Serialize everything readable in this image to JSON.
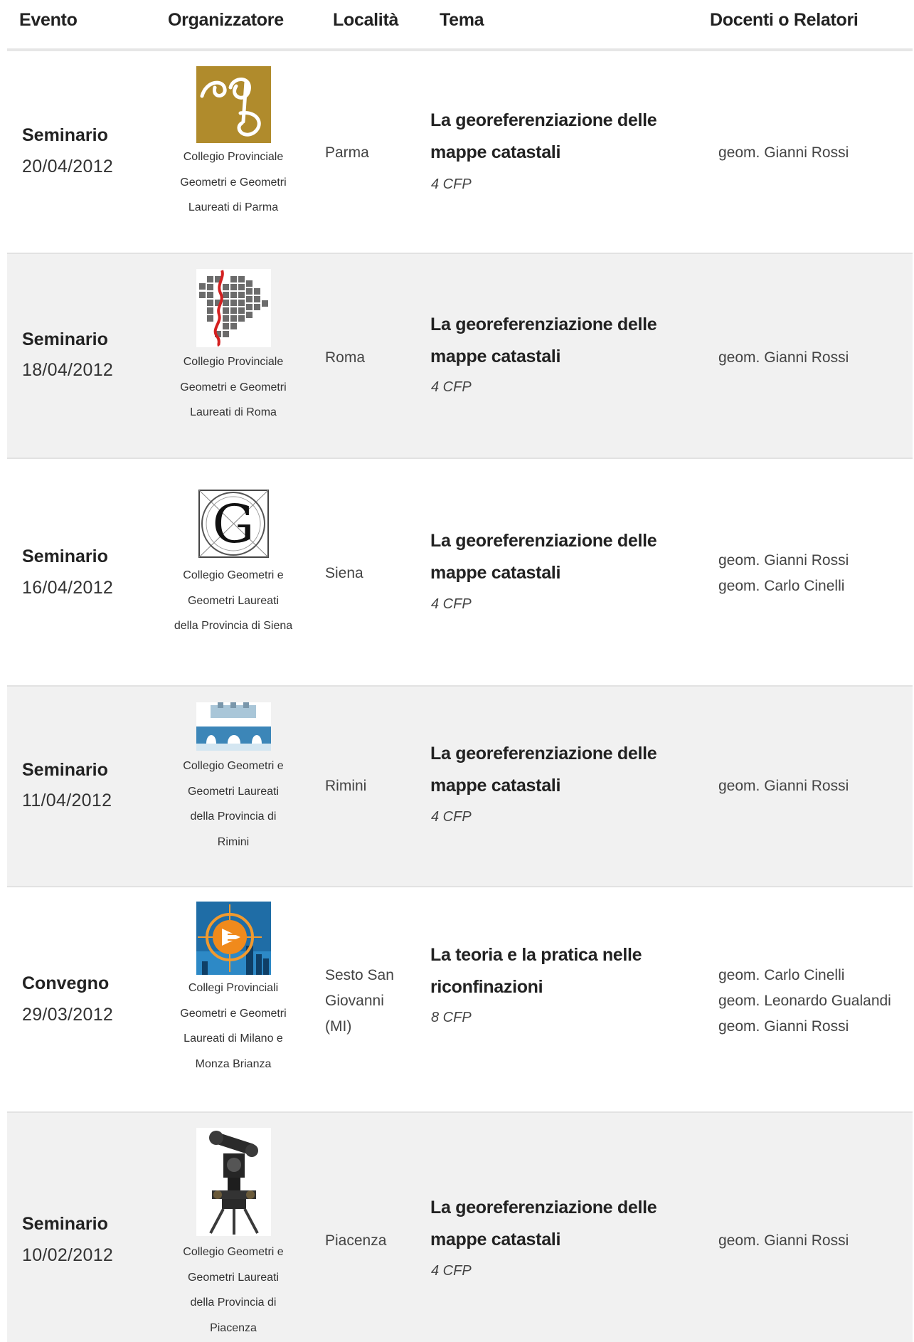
{
  "header": {
    "event": "Evento",
    "organizer": "Organizzatore",
    "location": "Località",
    "topic": "Tema",
    "speakers": "Docenti o Relatori"
  },
  "rows": [
    {
      "type": "Seminario",
      "date": "20/04/2012",
      "organizer_lines": [
        "Collegio Provinciale",
        "Geometri e Geometri",
        "Laureati di Parma"
      ],
      "organizer_logo": "cg-monogram-logo",
      "location_lines": [
        "Parma"
      ],
      "topic_lines": [
        "La georeferenziazione delle",
        "mappe catastali"
      ],
      "credits": "4 CFP",
      "speakers": [
        "geom. Gianni Rossi"
      ]
    },
    {
      "type": "Seminario",
      "date": "18/04/2012",
      "organizer_lines": [
        "Collegio Provinciale",
        "Geometri e Geometri",
        "Laureati di Roma"
      ],
      "organizer_logo": "cadastral-map-logo",
      "location_lines": [
        "Roma"
      ],
      "topic_lines": [
        "La georeferenziazione delle",
        "mappe catastali"
      ],
      "credits": "4 CFP",
      "speakers": [
        "geom. Gianni Rossi"
      ]
    },
    {
      "type": "Seminario",
      "date": "16/04/2012",
      "organizer_lines": [
        "Collegio Geometri e",
        "Geometri Laureati",
        "della Provincia di Siena"
      ],
      "organizer_logo": "letter-g-compass-logo",
      "location_lines": [
        "Siena"
      ],
      "topic_lines": [
        "La georeferenziazione delle",
        "mappe catastali"
      ],
      "credits": "4 CFP",
      "speakers": [
        "geom. Gianni Rossi",
        "geom. Carlo Cinelli"
      ]
    },
    {
      "type": "Seminario",
      "date": "11/04/2012",
      "organizer_lines": [
        "Collegio Geometri e",
        "Geometri Laureati",
        "della Provincia di",
        "Rimini"
      ],
      "organizer_logo": "bridge-arches-logo",
      "location_lines": [
        "Rimini"
      ],
      "topic_lines": [
        "La georeferenziazione delle",
        "mappe catastali"
      ],
      "credits": "4 CFP",
      "speakers": [
        "geom. Gianni Rossi"
      ]
    },
    {
      "type": "Convegno",
      "date": "29/03/2012",
      "organizer_lines": [
        "Collegi Provinciali",
        "Geometri e Geometri",
        "Laureati di Milano e",
        "Monza Brianza"
      ],
      "organizer_logo": "target-skyline-logo",
      "location_lines": [
        "Sesto San",
        "Giovanni",
        "(MI)"
      ],
      "topic_lines": [
        "La teoria e la pratica nelle",
        "riconfinazioni"
      ],
      "credits": "8 CFP",
      "speakers": [
        "geom. Carlo Cinelli",
        "geom. Leonardo Gualandi",
        "geom. Gianni Rossi"
      ]
    },
    {
      "type": "Seminario",
      "date": "10/02/2012",
      "organizer_lines": [
        "Collegio Geometri e",
        "Geometri Laureati",
        "della Provincia di",
        "Piacenza"
      ],
      "organizer_logo": "theodolite-instrument-logo",
      "location_lines": [
        "Piacenza"
      ],
      "topic_lines": [
        "La georeferenziazione delle",
        "mappe catastali"
      ],
      "credits": "4 CFP",
      "speakers": [
        "geom. Gianni Rossi"
      ]
    }
  ]
}
